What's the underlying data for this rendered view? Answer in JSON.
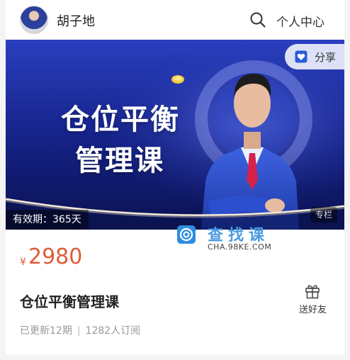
{
  "header": {
    "author_name": "胡子地",
    "user_center_label": "个人中心",
    "icons": {
      "search": "search-icon",
      "avatar": "avatar"
    }
  },
  "banner": {
    "title_line1": "仓位平衡",
    "title_line2": "管理课",
    "share_label": "分享",
    "validity": "有效期：365天",
    "column_tag": "专栏",
    "colors": {
      "bg_top": "#1a2fa8",
      "bg_bottom": "#0a1250",
      "accent": "#f6c93a"
    }
  },
  "watermark": {
    "title": "查找课",
    "url": "CHA.98KE.COM",
    "color": "#4a9be0"
  },
  "course": {
    "currency": "¥",
    "price": "2980",
    "title": "仓位平衡管理课",
    "gift_label": "送好友",
    "updated": "已更新12期",
    "subscribers": "1282人订阅",
    "price_color": "#e05a39"
  }
}
